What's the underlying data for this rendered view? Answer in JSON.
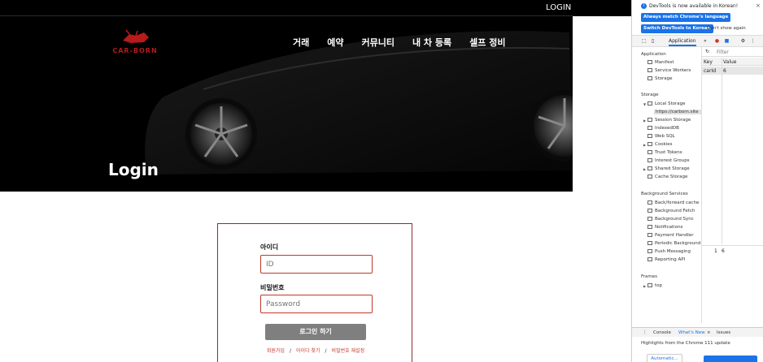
{
  "site": {
    "top_login": "LOGIN",
    "logo_text": "CAR-BORN",
    "nav": [
      "거래",
      "예약",
      "커뮤니티",
      "내 차 등록",
      "셀프 정비"
    ],
    "hero_title": "Login",
    "form": {
      "id_label": "아이디",
      "id_placeholder": "ID",
      "pw_label": "비밀번호",
      "pw_placeholder": "Password",
      "submit": "로그인 하기",
      "links": [
        "회원가입",
        "아이디 찾기",
        "비밀번호 재설정"
      ],
      "separator": "/"
    }
  },
  "devtools": {
    "info": "DevTools is now available in Korean!",
    "btn_match": "Always match Chrome's language",
    "btn_switch": "Switch DevTools to Korean",
    "dont_show": "Don't show again",
    "active_tab": "Application",
    "more_tabs": "»",
    "filter_label": "Filter",
    "table": {
      "headers": [
        "Key",
        "Value"
      ],
      "rows": [
        [
          "carId",
          "6"
        ]
      ]
    },
    "row_index": "1",
    "row_value": "6",
    "sections": {
      "application": "Application",
      "application_items": [
        "Manifest",
        "Service Workers",
        "Storage"
      ],
      "storage": "Storage",
      "storage_items": [
        "Local Storage",
        "https://carborn.site",
        "Session Storage",
        "IndexedDB",
        "Web SQL",
        "Cookies",
        "Trust Tokens",
        "Interest Groups",
        "Shared Storage",
        "Cache Storage"
      ],
      "background": "Background Services",
      "background_items": [
        "Back/forward cache",
        "Background Fetch",
        "Background Sync",
        "Notifications",
        "Payment Handler",
        "Periodic Background",
        "Push Messaging",
        "Reporting API"
      ],
      "frames": "Frames",
      "frames_items": [
        "top"
      ]
    },
    "drawer_tabs": [
      "Console",
      "What's New",
      "Issues"
    ],
    "highlight": "Highlights from the Chrome 111 update",
    "auto_btn": "Automatic..."
  },
  "colors": {
    "accent_red": "#c0392b",
    "devtools_blue": "#1a73e8",
    "hero_bg": "#000000"
  }
}
